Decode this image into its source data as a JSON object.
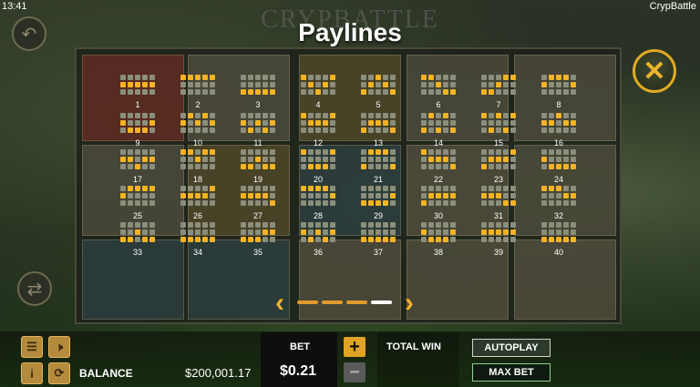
{
  "status": {
    "time": "13:41",
    "app_name": "CrypBattle"
  },
  "logo_text": "CRYPBATTLE",
  "title": "Paylines",
  "paylines": [
    {
      "n": "1",
      "rows": [
        [
          0,
          0,
          0,
          0,
          0
        ],
        [
          1,
          1,
          1,
          1,
          1
        ],
        [
          0,
          0,
          0,
          0,
          0
        ]
      ]
    },
    {
      "n": "2",
      "rows": [
        [
          1,
          1,
          1,
          1,
          1
        ],
        [
          0,
          0,
          0,
          0,
          0
        ],
        [
          0,
          0,
          0,
          0,
          0
        ]
      ]
    },
    {
      "n": "3",
      "rows": [
        [
          0,
          0,
          0,
          0,
          0
        ],
        [
          0,
          0,
          0,
          0,
          0
        ],
        [
          1,
          1,
          1,
          1,
          1
        ]
      ]
    },
    {
      "n": "4",
      "rows": [
        [
          1,
          0,
          0,
          0,
          1
        ],
        [
          0,
          1,
          0,
          1,
          0
        ],
        [
          0,
          0,
          1,
          0,
          0
        ]
      ]
    },
    {
      "n": "5",
      "rows": [
        [
          0,
          0,
          1,
          0,
          0
        ],
        [
          0,
          1,
          0,
          1,
          0
        ],
        [
          1,
          0,
          0,
          0,
          1
        ]
      ]
    },
    {
      "n": "6",
      "rows": [
        [
          1,
          1,
          0,
          0,
          0
        ],
        [
          0,
          0,
          1,
          0,
          0
        ],
        [
          0,
          0,
          0,
          1,
          1
        ]
      ]
    },
    {
      "n": "7",
      "rows": [
        [
          0,
          0,
          0,
          1,
          1
        ],
        [
          0,
          0,
          1,
          0,
          0
        ],
        [
          1,
          1,
          0,
          0,
          0
        ]
      ]
    },
    {
      "n": "8",
      "rows": [
        [
          0,
          1,
          1,
          1,
          0
        ],
        [
          1,
          0,
          0,
          0,
          1
        ],
        [
          0,
          0,
          0,
          0,
          0
        ]
      ]
    },
    {
      "n": "9",
      "rows": [
        [
          0,
          0,
          0,
          0,
          0
        ],
        [
          1,
          0,
          0,
          0,
          1
        ],
        [
          0,
          1,
          1,
          1,
          0
        ]
      ]
    },
    {
      "n": "10",
      "rows": [
        [
          0,
          1,
          0,
          1,
          0
        ],
        [
          1,
          0,
          1,
          0,
          1
        ],
        [
          0,
          0,
          0,
          0,
          0
        ]
      ]
    },
    {
      "n": "11",
      "rows": [
        [
          0,
          0,
          0,
          0,
          0
        ],
        [
          1,
          0,
          1,
          0,
          1
        ],
        [
          0,
          1,
          0,
          1,
          0
        ]
      ]
    },
    {
      "n": "12",
      "rows": [
        [
          1,
          0,
          0,
          0,
          1
        ],
        [
          0,
          1,
          1,
          1,
          0
        ],
        [
          0,
          0,
          0,
          0,
          0
        ]
      ]
    },
    {
      "n": "13",
      "rows": [
        [
          0,
          0,
          0,
          0,
          0
        ],
        [
          0,
          1,
          1,
          1,
          0
        ],
        [
          1,
          0,
          0,
          0,
          1
        ]
      ]
    },
    {
      "n": "14",
      "rows": [
        [
          0,
          1,
          0,
          1,
          0
        ],
        [
          0,
          0,
          0,
          0,
          0
        ],
        [
          1,
          0,
          1,
          0,
          1
        ]
      ]
    },
    {
      "n": "15",
      "rows": [
        [
          1,
          0,
          1,
          0,
          1
        ],
        [
          0,
          0,
          0,
          0,
          0
        ],
        [
          0,
          1,
          0,
          1,
          0
        ]
      ]
    },
    {
      "n": "16",
      "rows": [
        [
          0,
          0,
          1,
          0,
          0
        ],
        [
          1,
          1,
          0,
          1,
          1
        ],
        [
          0,
          0,
          0,
          0,
          0
        ]
      ]
    },
    {
      "n": "17",
      "rows": [
        [
          0,
          0,
          0,
          0,
          0
        ],
        [
          1,
          1,
          0,
          1,
          1
        ],
        [
          0,
          0,
          1,
          0,
          0
        ]
      ]
    },
    {
      "n": "18",
      "rows": [
        [
          1,
          1,
          0,
          1,
          1
        ],
        [
          0,
          0,
          1,
          0,
          0
        ],
        [
          0,
          0,
          0,
          0,
          0
        ]
      ]
    },
    {
      "n": "19",
      "rows": [
        [
          0,
          0,
          0,
          0,
          0
        ],
        [
          0,
          0,
          1,
          0,
          0
        ],
        [
          1,
          1,
          0,
          1,
          1
        ]
      ]
    },
    {
      "n": "20",
      "rows": [
        [
          1,
          0,
          0,
          0,
          1
        ],
        [
          0,
          0,
          0,
          0,
          0
        ],
        [
          0,
          1,
          1,
          1,
          0
        ]
      ]
    },
    {
      "n": "21",
      "rows": [
        [
          0,
          1,
          1,
          1,
          0
        ],
        [
          0,
          0,
          0,
          0,
          0
        ],
        [
          1,
          0,
          0,
          0,
          1
        ]
      ]
    },
    {
      "n": "22",
      "rows": [
        [
          1,
          0,
          0,
          0,
          0
        ],
        [
          0,
          1,
          1,
          1,
          0
        ],
        [
          0,
          0,
          0,
          0,
          1
        ]
      ]
    },
    {
      "n": "23",
      "rows": [
        [
          0,
          0,
          0,
          0,
          1
        ],
        [
          0,
          1,
          1,
          1,
          0
        ],
        [
          1,
          0,
          0,
          0,
          0
        ]
      ]
    },
    {
      "n": "24",
      "rows": [
        [
          0,
          0,
          0,
          0,
          0
        ],
        [
          1,
          0,
          0,
          0,
          0
        ],
        [
          0,
          1,
          1,
          1,
          1
        ]
      ]
    },
    {
      "n": "25",
      "rows": [
        [
          0,
          1,
          1,
          1,
          1
        ],
        [
          1,
          0,
          0,
          0,
          0
        ],
        [
          0,
          0,
          0,
          0,
          0
        ]
      ]
    },
    {
      "n": "26",
      "rows": [
        [
          0,
          0,
          0,
          0,
          1
        ],
        [
          1,
          1,
          1,
          1,
          0
        ],
        [
          0,
          0,
          0,
          0,
          0
        ]
      ]
    },
    {
      "n": "27",
      "rows": [
        [
          0,
          0,
          0,
          0,
          0
        ],
        [
          1,
          1,
          1,
          1,
          0
        ],
        [
          0,
          0,
          0,
          0,
          1
        ]
      ]
    },
    {
      "n": "28",
      "rows": [
        [
          1,
          1,
          1,
          1,
          0
        ],
        [
          0,
          0,
          0,
          0,
          1
        ],
        [
          0,
          0,
          0,
          0,
          0
        ]
      ]
    },
    {
      "n": "29",
      "rows": [
        [
          0,
          0,
          0,
          0,
          0
        ],
        [
          0,
          0,
          0,
          0,
          1
        ],
        [
          1,
          1,
          1,
          1,
          0
        ]
      ]
    },
    {
      "n": "30",
      "rows": [
        [
          0,
          0,
          0,
          0,
          0
        ],
        [
          0,
          1,
          1,
          1,
          1
        ],
        [
          1,
          0,
          0,
          0,
          0
        ]
      ]
    },
    {
      "n": "31",
      "rows": [
        [
          0,
          0,
          0,
          0,
          0
        ],
        [
          1,
          1,
          1,
          0,
          0
        ],
        [
          0,
          0,
          0,
          1,
          1
        ]
      ]
    },
    {
      "n": "32",
      "rows": [
        [
          1,
          1,
          1,
          0,
          0
        ],
        [
          0,
          0,
          0,
          1,
          1
        ],
        [
          0,
          0,
          0,
          0,
          0
        ]
      ]
    },
    {
      "n": "33",
      "rows": [
        [
          0,
          0,
          0,
          0,
          0
        ],
        [
          0,
          0,
          1,
          0,
          0
        ],
        [
          1,
          1,
          0,
          1,
          1
        ]
      ]
    },
    {
      "n": "34",
      "rows": [
        [
          0,
          0,
          0,
          0,
          0
        ],
        [
          0,
          0,
          0,
          0,
          0
        ],
        [
          1,
          1,
          1,
          1,
          1
        ]
      ]
    },
    {
      "n": "35",
      "rows": [
        [
          0,
          0,
          0,
          0,
          0
        ],
        [
          0,
          0,
          0,
          1,
          1
        ],
        [
          1,
          1,
          1,
          0,
          0
        ]
      ]
    },
    {
      "n": "36",
      "rows": [
        [
          0,
          0,
          0,
          0,
          0
        ],
        [
          1,
          0,
          1,
          0,
          1
        ],
        [
          0,
          1,
          0,
          1,
          0
        ]
      ]
    },
    {
      "n": "37",
      "rows": [
        [
          0,
          0,
          0,
          0,
          0
        ],
        [
          0,
          0,
          0,
          0,
          0
        ],
        [
          1,
          1,
          1,
          1,
          1
        ]
      ]
    },
    {
      "n": "38",
      "rows": [
        [
          0,
          0,
          0,
          0,
          0
        ],
        [
          1,
          0,
          0,
          0,
          1
        ],
        [
          0,
          1,
          1,
          1,
          0
        ]
      ]
    },
    {
      "n": "39",
      "rows": [
        [
          0,
          0,
          0,
          0,
          0
        ],
        [
          1,
          1,
          1,
          1,
          1
        ],
        [
          0,
          0,
          0,
          0,
          0
        ]
      ]
    },
    {
      "n": "40",
      "rows": [
        [
          0,
          0,
          0,
          0,
          0
        ],
        [
          0,
          0,
          0,
          0,
          0
        ],
        [
          1,
          1,
          1,
          1,
          1
        ]
      ]
    }
  ],
  "pager": {
    "pages": 4,
    "active_page": 4
  },
  "footer": {
    "balance_label": "BALANCE",
    "balance_value": "$200,001.17",
    "bet_label": "BET",
    "bet_value": "$0.21",
    "total_win_label": "TOTAL WIN",
    "autoplay_label": "AUTOPLAY",
    "maxbet_label": "MAX BET"
  },
  "colors": {
    "accent": "#f3b323",
    "dot_off": "#8b8e7b"
  }
}
